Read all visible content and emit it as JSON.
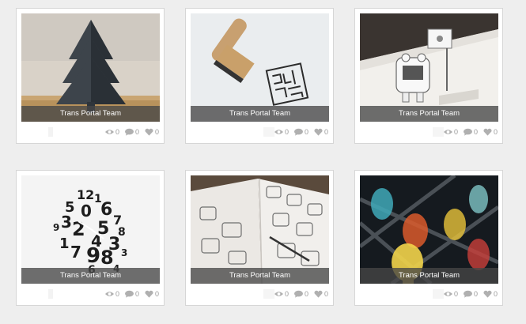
{
  "cards": [
    {
      "author": "Trans Portal Team",
      "image": "paper-christmas-tree",
      "views": "0",
      "comments": "0",
      "likes": "0"
    },
    {
      "author": "Trans Portal Team",
      "image": "rubber-stamp",
      "views": "0",
      "comments": "0",
      "likes": "0"
    },
    {
      "author": "Trans Portal Team",
      "image": "pop-up-robot-card",
      "views": "0",
      "comments": "0",
      "likes": "0"
    },
    {
      "author": "Trans Portal Team",
      "image": "number-wall-clock",
      "views": "0",
      "comments": "0",
      "likes": "0"
    },
    {
      "author": "Trans Portal Team",
      "image": "sketchbook-drawings",
      "views": "0",
      "comments": "0",
      "likes": "0"
    },
    {
      "author": "Trans Portal Team",
      "image": "light-bulb-poster",
      "views": "0",
      "comments": "0",
      "likes": "0"
    }
  ],
  "icons": {
    "views": "eye-icon",
    "comments": "comment-icon",
    "likes": "heart-icon"
  },
  "colors": {
    "background": "#eeeeee",
    "card": "#ffffff",
    "caption_bg": "#464646",
    "stat_text": "#9a9a9a"
  }
}
